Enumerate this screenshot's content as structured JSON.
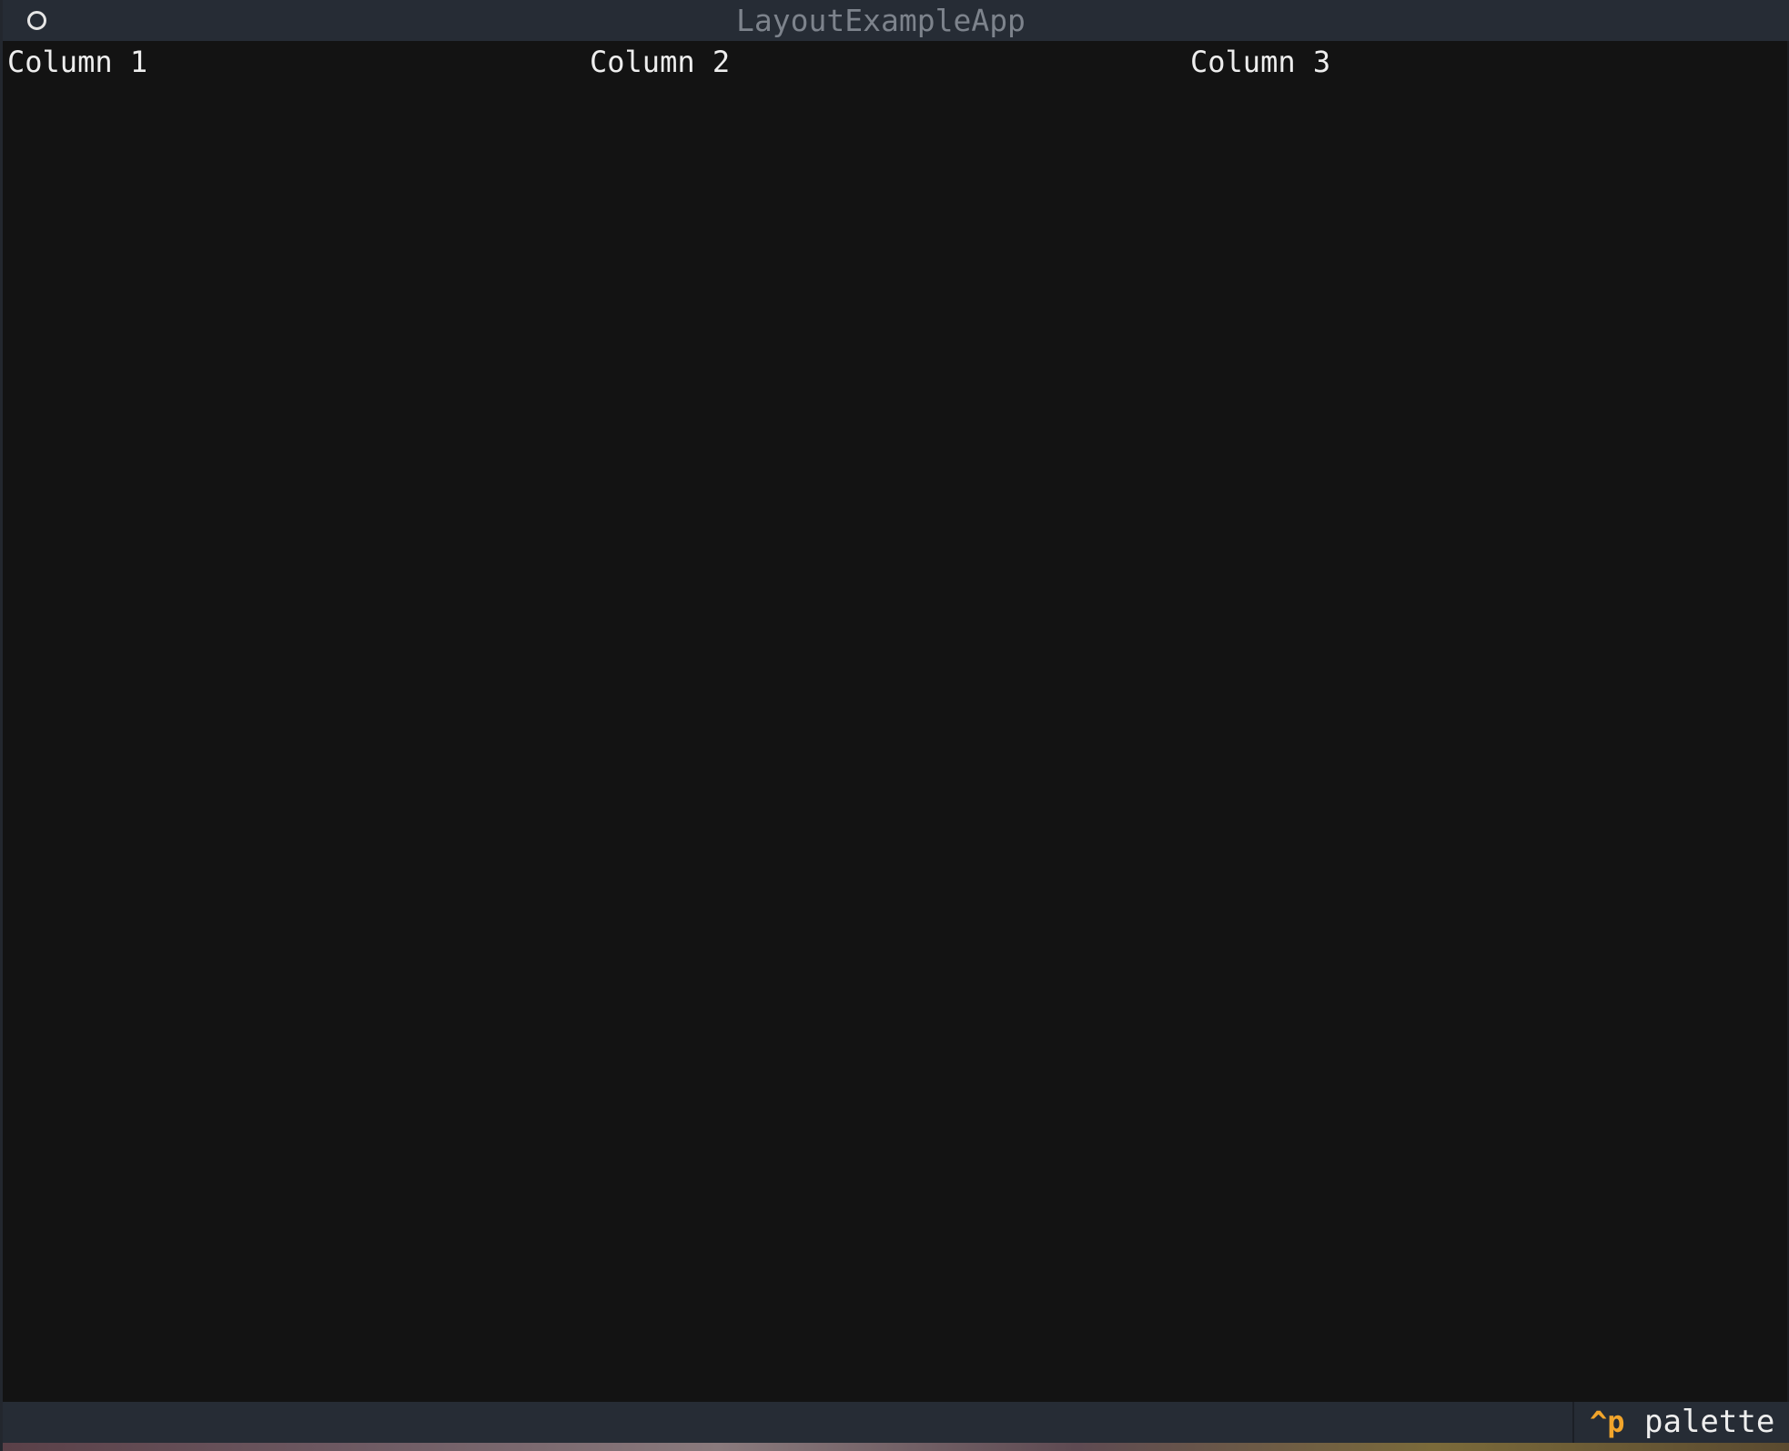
{
  "window": {
    "title": "LayoutExampleApp",
    "icon": "circle-icon"
  },
  "columns": [
    {
      "label": "Column 1"
    },
    {
      "label": "Column 2"
    },
    {
      "label": "Column 3"
    }
  ],
  "footer": {
    "key": "^p",
    "label": "palette"
  },
  "colors": {
    "background": "#131313",
    "header_bar": "#262c35",
    "title_text": "#7d838c",
    "accent_key": "#f2a52b",
    "text": "#eeeeee"
  }
}
